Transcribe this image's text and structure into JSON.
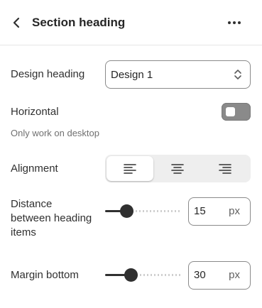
{
  "header": {
    "title": "Section heading",
    "back_icon": "chevron-left-icon",
    "more_icon": "ellipsis-icon"
  },
  "design_heading": {
    "label": "Design heading",
    "selected": "Design 1",
    "icon": "select-chevron-icon"
  },
  "horizontal": {
    "label": "Horizontal",
    "hint": "Only work on desktop",
    "enabled": false
  },
  "alignment": {
    "label": "Alignment",
    "options": [
      {
        "name": "left",
        "icon": "align-left-icon",
        "active": true
      },
      {
        "name": "center",
        "icon": "align-center-icon",
        "active": false
      },
      {
        "name": "right",
        "icon": "align-right-icon",
        "active": false
      }
    ]
  },
  "distance": {
    "label_line1": "Distance",
    "label_line2": "between heading",
    "label_line3": "items",
    "value": "15",
    "unit": "px",
    "slider_fraction": 0.28
  },
  "margin_bottom": {
    "label": "Margin bottom",
    "value": "30",
    "unit": "px",
    "slider_fraction": 0.33
  },
  "colors": {
    "text": "#303030",
    "muted": "#707070",
    "border": "#8a8a8a",
    "toggle_off": "#8a8a8a",
    "segment_bg": "#eeeeee"
  }
}
